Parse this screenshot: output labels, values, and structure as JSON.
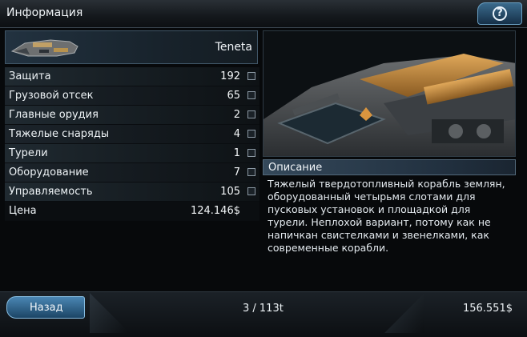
{
  "window": {
    "title": "Информация",
    "help_icon": "question-icon"
  },
  "ship": {
    "name": "Teneta"
  },
  "stats": [
    {
      "label": "Защита",
      "value": "192"
    },
    {
      "label": "Грузовой отсек",
      "value": "65"
    },
    {
      "label": "Главные орудия",
      "value": "2"
    },
    {
      "label": "Тяжелые снаряды",
      "value": "4"
    },
    {
      "label": "Турели",
      "value": "1"
    },
    {
      "label": "Оборудование",
      "value": "7"
    },
    {
      "label": "Управляемость",
      "value": "105"
    }
  ],
  "price": {
    "label": "Цена",
    "value": "124.146$"
  },
  "description": {
    "title": "Описание",
    "text": "Тяжелый твердотопливный корабль землян, оборудованный четырьмя слотами для пусковых установок и площадкой для турели. Неплохой вариант, потому как не напичкан свистелками и звенелками, как современные корабли."
  },
  "footer": {
    "back_label": "Назад",
    "page_counter": "3 / 113t",
    "money": "156.551$"
  },
  "colors": {
    "accent": "#4a86b3",
    "panel": "#18232c",
    "text": "#eef3f6"
  }
}
